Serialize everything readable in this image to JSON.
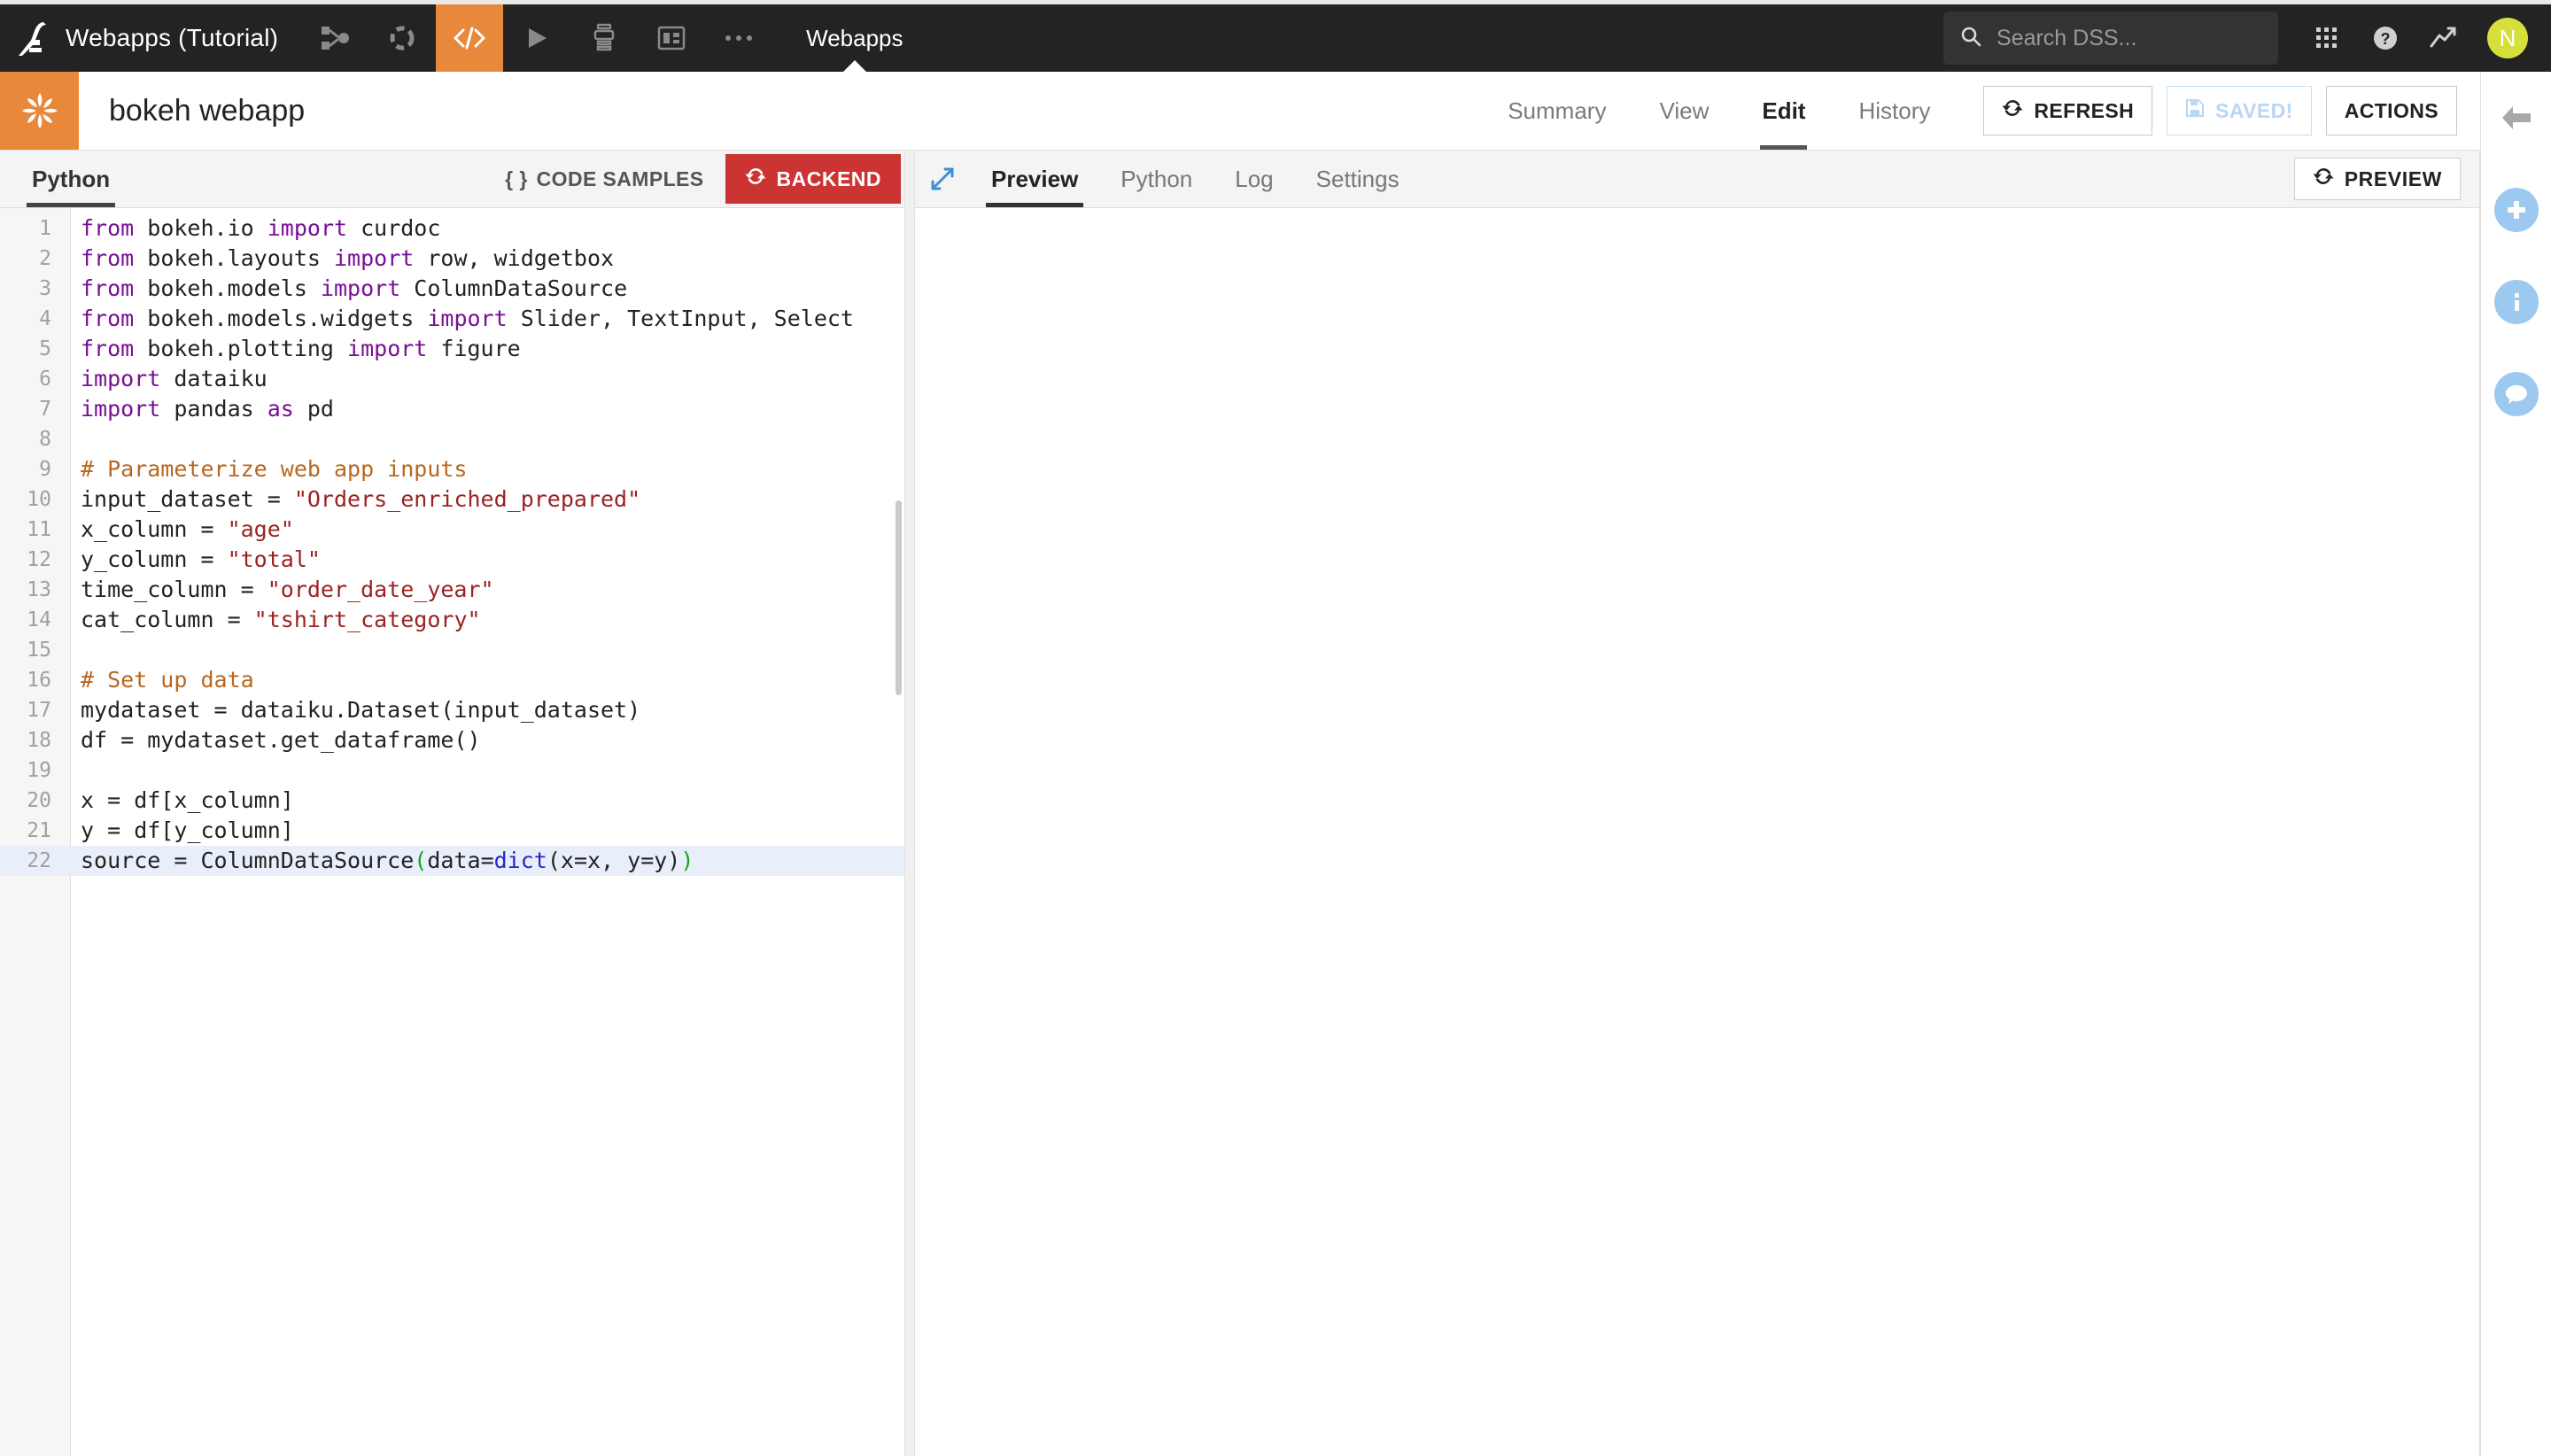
{
  "navbar": {
    "logo_icon": "dataiku-bird-logo",
    "project_name": "Webapps (Tutorial)",
    "icons": [
      {
        "name": "flow-icon",
        "glyph": "flow"
      },
      {
        "name": "lab-icon",
        "glyph": "lab"
      },
      {
        "name": "code-icon",
        "glyph": "code",
        "active": true
      },
      {
        "name": "run-icon",
        "glyph": "play"
      },
      {
        "name": "jobs-icon",
        "glyph": "jobs"
      },
      {
        "name": "dashboard-icon",
        "glyph": "dashboard"
      },
      {
        "name": "more-icon",
        "glyph": "ellipsis"
      }
    ],
    "section_label": "Webapps",
    "search": {
      "placeholder": "Search DSS...",
      "value": "",
      "icon": "search-icon"
    },
    "right_icons": [
      {
        "name": "apps-grid-icon"
      },
      {
        "name": "help-icon"
      },
      {
        "name": "activity-icon"
      }
    ],
    "avatar_initial": "N",
    "avatar_color": "#d7e03a",
    "background": "#232323",
    "accent": "#e8883a"
  },
  "project_header": {
    "badge_icon": "webapp-pinwheel-icon",
    "badge_color": "#e8883a",
    "title": "bokeh webapp",
    "tabs": [
      {
        "label": "Summary",
        "active": false
      },
      {
        "label": "View",
        "active": false
      },
      {
        "label": "Edit",
        "active": true
      },
      {
        "label": "History",
        "active": false
      }
    ],
    "buttons": [
      {
        "label": "REFRESH",
        "icon": "refresh-icon",
        "disabled": false
      },
      {
        "label": "SAVED!",
        "icon": "save-disk-icon",
        "disabled": true
      },
      {
        "label": "ACTIONS",
        "icon": "",
        "disabled": false
      }
    ],
    "collapse_icon": "arrow-left-icon"
  },
  "editor": {
    "language_tab": "Python",
    "code_samples_label": "CODE SAMPLES",
    "code_samples_icon": "braces-icon",
    "backend_label": "BACKEND",
    "backend_icon": "refresh-icon",
    "backend_color": "#c33",
    "lines": [
      {
        "n": 1,
        "tokens": [
          {
            "t": "from ",
            "c": "k"
          },
          {
            "t": "bokeh.io ",
            "c": ""
          },
          {
            "t": "import ",
            "c": "k"
          },
          {
            "t": "curdoc",
            "c": ""
          }
        ]
      },
      {
        "n": 2,
        "tokens": [
          {
            "t": "from ",
            "c": "k"
          },
          {
            "t": "bokeh.layouts ",
            "c": ""
          },
          {
            "t": "import ",
            "c": "k"
          },
          {
            "t": "row, widgetbox",
            "c": ""
          }
        ]
      },
      {
        "n": 3,
        "tokens": [
          {
            "t": "from ",
            "c": "k"
          },
          {
            "t": "bokeh.models ",
            "c": ""
          },
          {
            "t": "import ",
            "c": "k"
          },
          {
            "t": "ColumnDataSource",
            "c": ""
          }
        ]
      },
      {
        "n": 4,
        "tokens": [
          {
            "t": "from ",
            "c": "k"
          },
          {
            "t": "bokeh.models.widgets ",
            "c": ""
          },
          {
            "t": "import ",
            "c": "k"
          },
          {
            "t": "Slider, TextInput, Select",
            "c": ""
          }
        ]
      },
      {
        "n": 5,
        "tokens": [
          {
            "t": "from ",
            "c": "k"
          },
          {
            "t": "bokeh.plotting ",
            "c": ""
          },
          {
            "t": "import ",
            "c": "k"
          },
          {
            "t": "figure",
            "c": ""
          }
        ]
      },
      {
        "n": 6,
        "tokens": [
          {
            "t": "import ",
            "c": "k"
          },
          {
            "t": "dataiku",
            "c": ""
          }
        ]
      },
      {
        "n": 7,
        "tokens": [
          {
            "t": "import ",
            "c": "k"
          },
          {
            "t": "pandas ",
            "c": ""
          },
          {
            "t": "as ",
            "c": "k"
          },
          {
            "t": "pd",
            "c": ""
          }
        ]
      },
      {
        "n": 8,
        "tokens": []
      },
      {
        "n": 9,
        "tokens": [
          {
            "t": "# Parameterize web app inputs",
            "c": "cm"
          }
        ]
      },
      {
        "n": 10,
        "tokens": [
          {
            "t": "input_dataset = ",
            "c": ""
          },
          {
            "t": "\"Orders_enriched_prepared\"",
            "c": "s"
          }
        ]
      },
      {
        "n": 11,
        "tokens": [
          {
            "t": "x_column = ",
            "c": ""
          },
          {
            "t": "\"age\"",
            "c": "s"
          }
        ]
      },
      {
        "n": 12,
        "tokens": [
          {
            "t": "y_column = ",
            "c": ""
          },
          {
            "t": "\"total\"",
            "c": "s"
          }
        ]
      },
      {
        "n": 13,
        "tokens": [
          {
            "t": "time_column = ",
            "c": ""
          },
          {
            "t": "\"order_date_year\"",
            "c": "s"
          }
        ]
      },
      {
        "n": 14,
        "tokens": [
          {
            "t": "cat_column = ",
            "c": ""
          },
          {
            "t": "\"tshirt_category\"",
            "c": "s"
          }
        ]
      },
      {
        "n": 15,
        "tokens": []
      },
      {
        "n": 16,
        "tokens": [
          {
            "t": "# Set up data",
            "c": "cm"
          }
        ]
      },
      {
        "n": 17,
        "tokens": [
          {
            "t": "mydataset = dataiku.Dataset(input_dataset)",
            "c": ""
          }
        ]
      },
      {
        "n": 18,
        "tokens": [
          {
            "t": "df = mydataset.get_dataframe()",
            "c": ""
          }
        ]
      },
      {
        "n": 19,
        "tokens": []
      },
      {
        "n": 20,
        "tokens": [
          {
            "t": "x = df[x_column]",
            "c": ""
          }
        ]
      },
      {
        "n": 21,
        "tokens": [
          {
            "t": "y = df[y_column]",
            "c": ""
          }
        ]
      },
      {
        "n": 22,
        "active": true,
        "tokens": [
          {
            "t": "source = ColumnDataSource",
            "c": ""
          },
          {
            "t": "(",
            "c": "pm"
          },
          {
            "t": "data=",
            "c": ""
          },
          {
            "t": "dict",
            "c": "bi"
          },
          {
            "t": "(x=x, y=y)",
            "c": ""
          },
          {
            "t": ")",
            "c": "pm"
          }
        ]
      }
    ]
  },
  "preview": {
    "expand_icon": "expand-arrows-icon",
    "tabs": [
      {
        "label": "Preview",
        "active": true
      },
      {
        "label": "Python",
        "active": false
      },
      {
        "label": "Log",
        "active": false
      },
      {
        "label": "Settings",
        "active": false
      }
    ],
    "button": {
      "label": "PREVIEW",
      "icon": "refresh-icon"
    },
    "body_content": ""
  },
  "right_rail": {
    "items": [
      {
        "name": "collapse-arrow-icon",
        "style": "plain"
      },
      {
        "name": "add-icon",
        "style": "circle"
      },
      {
        "name": "info-icon",
        "style": "circle"
      },
      {
        "name": "discussions-icon",
        "style": "circle"
      }
    ],
    "circle_color": "#9dc8f0"
  }
}
